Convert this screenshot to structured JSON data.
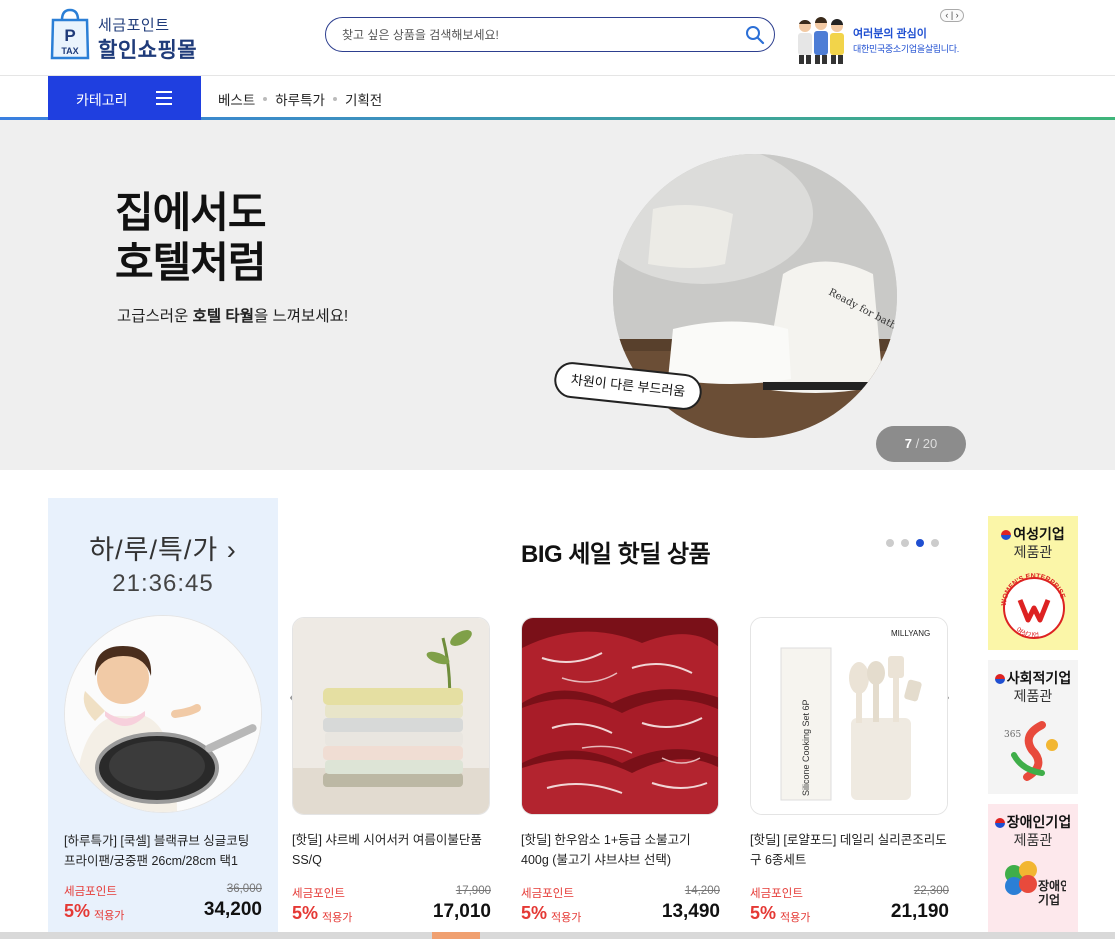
{
  "logo": {
    "top": "세금포인트",
    "main": "할인쇼핑몰",
    "bag_p": "P",
    "bag_tax": "TAX"
  },
  "search": {
    "placeholder": "찾고 싶은 상품을 검색해보세요!"
  },
  "promo": {
    "line1": "여러분의 관심이",
    "line2": "대한민국중소기업을살립니다.",
    "nav": "‹ | ›"
  },
  "nav": {
    "category_label": "카테고리",
    "links": [
      "베스트",
      "하루특가",
      "기획전"
    ]
  },
  "banner": {
    "title_line1": "집에서도",
    "title_line2": "호텔처럼",
    "sub_pre": "고급스러운 ",
    "sub_bold": "호텔 타월",
    "sub_post": "을 느껴보세요!",
    "bubble": "차원이 다른 부드러움",
    "towel_text": "Ready for bath",
    "page_current": "7",
    "page_sep": " / ",
    "page_total": "20"
  },
  "today": {
    "title": "하/루/특/가",
    "chevron": "›",
    "time": "21:36:45",
    "name": "[하루특가] [쿡셀] 블랙큐브 싱글코팅 프라이팬/궁중팬 26cm/28cm 택1",
    "price_label": "세금포인트",
    "original": "36,000",
    "discount": "5%",
    "apply": "적용가",
    "price": "34,200"
  },
  "section": {
    "title": "BIG 세일 핫딜 상품",
    "prev": "‹",
    "next": "›"
  },
  "products": [
    {
      "name": "[핫딜] 샤르베 시어서커 여름이불단품 SS/Q",
      "price_label": "세금포인트",
      "original": "17,900",
      "discount": "5%",
      "apply": "적용가",
      "price": "17,010"
    },
    {
      "name": "[핫딜] 한우암소 1+등급 소불고기 400g (불고기 샤브샤브 선택)",
      "price_label": "세금포인트",
      "original": "14,200",
      "discount": "5%",
      "apply": "적용가",
      "price": "13,490"
    },
    {
      "name": "[핫딜] [로얄포드] 데일리 실리콘조리도구 6종세트",
      "price_label": "세금포인트",
      "original": "22,300",
      "discount": "5%",
      "apply": "적용가",
      "price": "21,190",
      "brand": "MILLYANG",
      "box_text": "Silicone Cooking Set 6P"
    }
  ],
  "badges": [
    {
      "line1": "여성기업",
      "line2": "제품관",
      "seal_text": "WOMEN'S ENTERPRISE",
      "seal_sub": "여성기업"
    },
    {
      "line1": "사회적기업",
      "line2": "제품관"
    },
    {
      "line1": "장애인기업",
      "line2": "제품관",
      "logo_text1": "장애인",
      "logo_text2": "기업"
    }
  ],
  "colors": {
    "primary": "#1f3fe0",
    "accent_red": "#e53935",
    "navy": "#1f3b7a",
    "today_bg": "#e8f1fc",
    "banner_bg": "#efefef"
  }
}
